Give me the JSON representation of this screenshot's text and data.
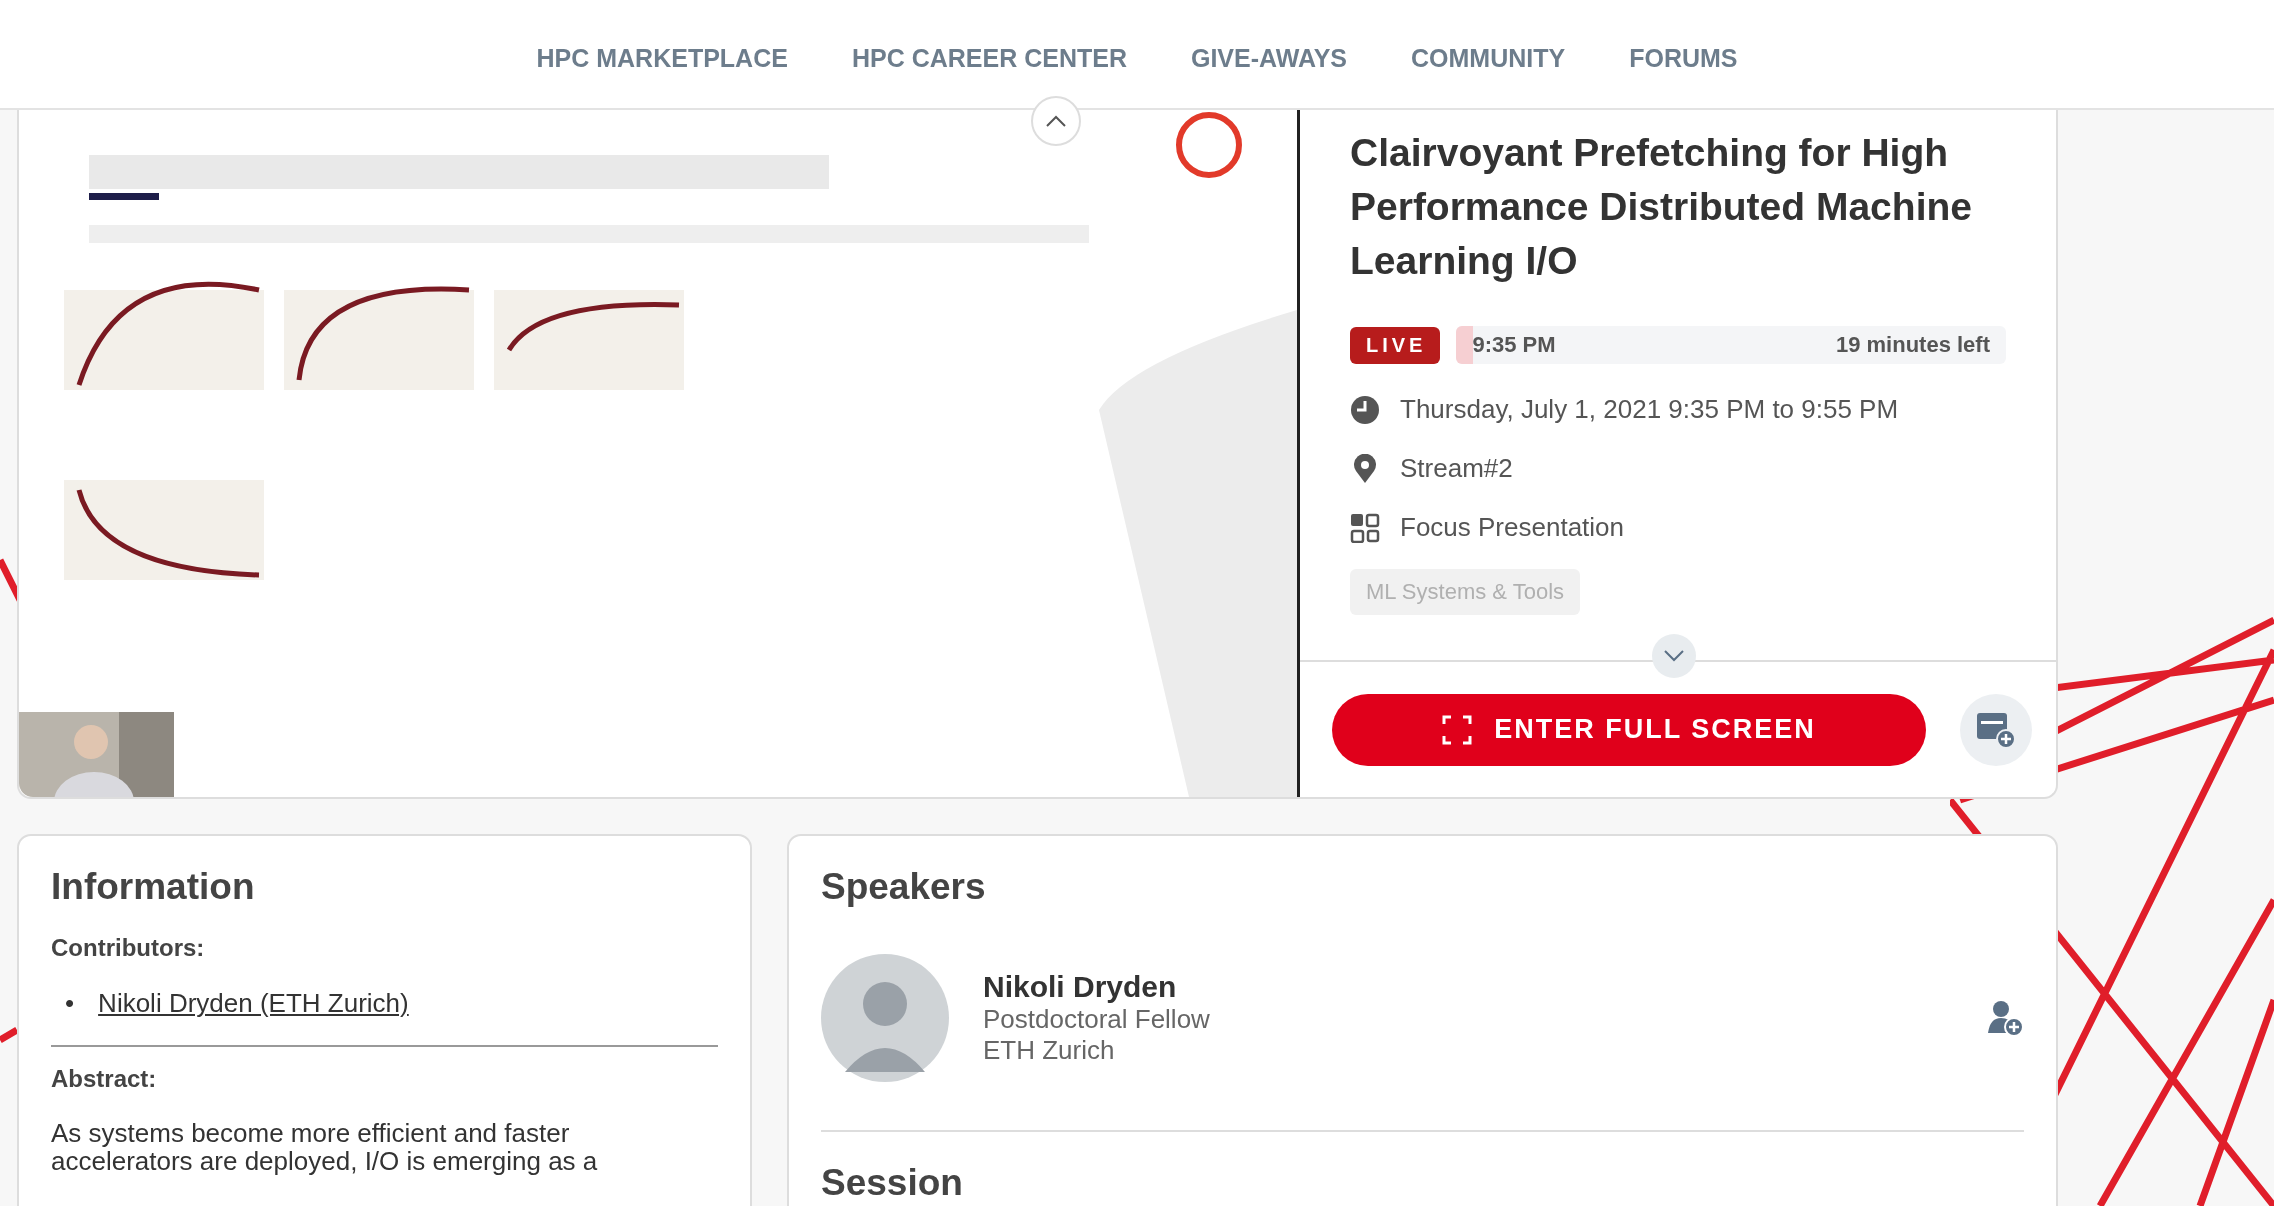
{
  "nav": [
    {
      "label": "HPC MARKETPLACE"
    },
    {
      "label": "HPC CAREER CENTER"
    },
    {
      "label": "GIVE-AWAYS"
    },
    {
      "label": "COMMUNITY"
    },
    {
      "label": "FORUMS"
    }
  ],
  "session": {
    "title": "Clairvoyant Prefetching for High Performance Distributed Machine Learning I/O",
    "live_badge": "LIVE",
    "start": "9:35 PM",
    "remaining": "19 minutes left",
    "level": 0.03,
    "details": [
      {
        "kind": "time",
        "text": "Thursday, July 1, 2021 9:35 PM to 9:55 PM"
      },
      {
        "kind": "location",
        "text": "Stream#2"
      },
      {
        "kind": "format",
        "text": "Focus Presentation"
      }
    ],
    "tags": [
      "ML Systems & Tools"
    ],
    "primary_button": "ENTER FULL SCREEN"
  },
  "information": {
    "title": "Information",
    "contributors_label": "Contributors:",
    "marker": "•",
    "contributors": [
      "Nikoli Dryden (ETH Zurich)"
    ],
    "abstract_label": "Abstract:",
    "abstract": "As systems become more efficient and faster accelerators are deployed, I/O is emerging as a"
  },
  "speakers": {
    "title": "Speakers",
    "people": [
      {
        "name": "Nikoli Dryden",
        "role": "Postdoctoral Fellow",
        "affiliation": "ETH Zurich"
      }
    ],
    "next_section": "Session"
  }
}
